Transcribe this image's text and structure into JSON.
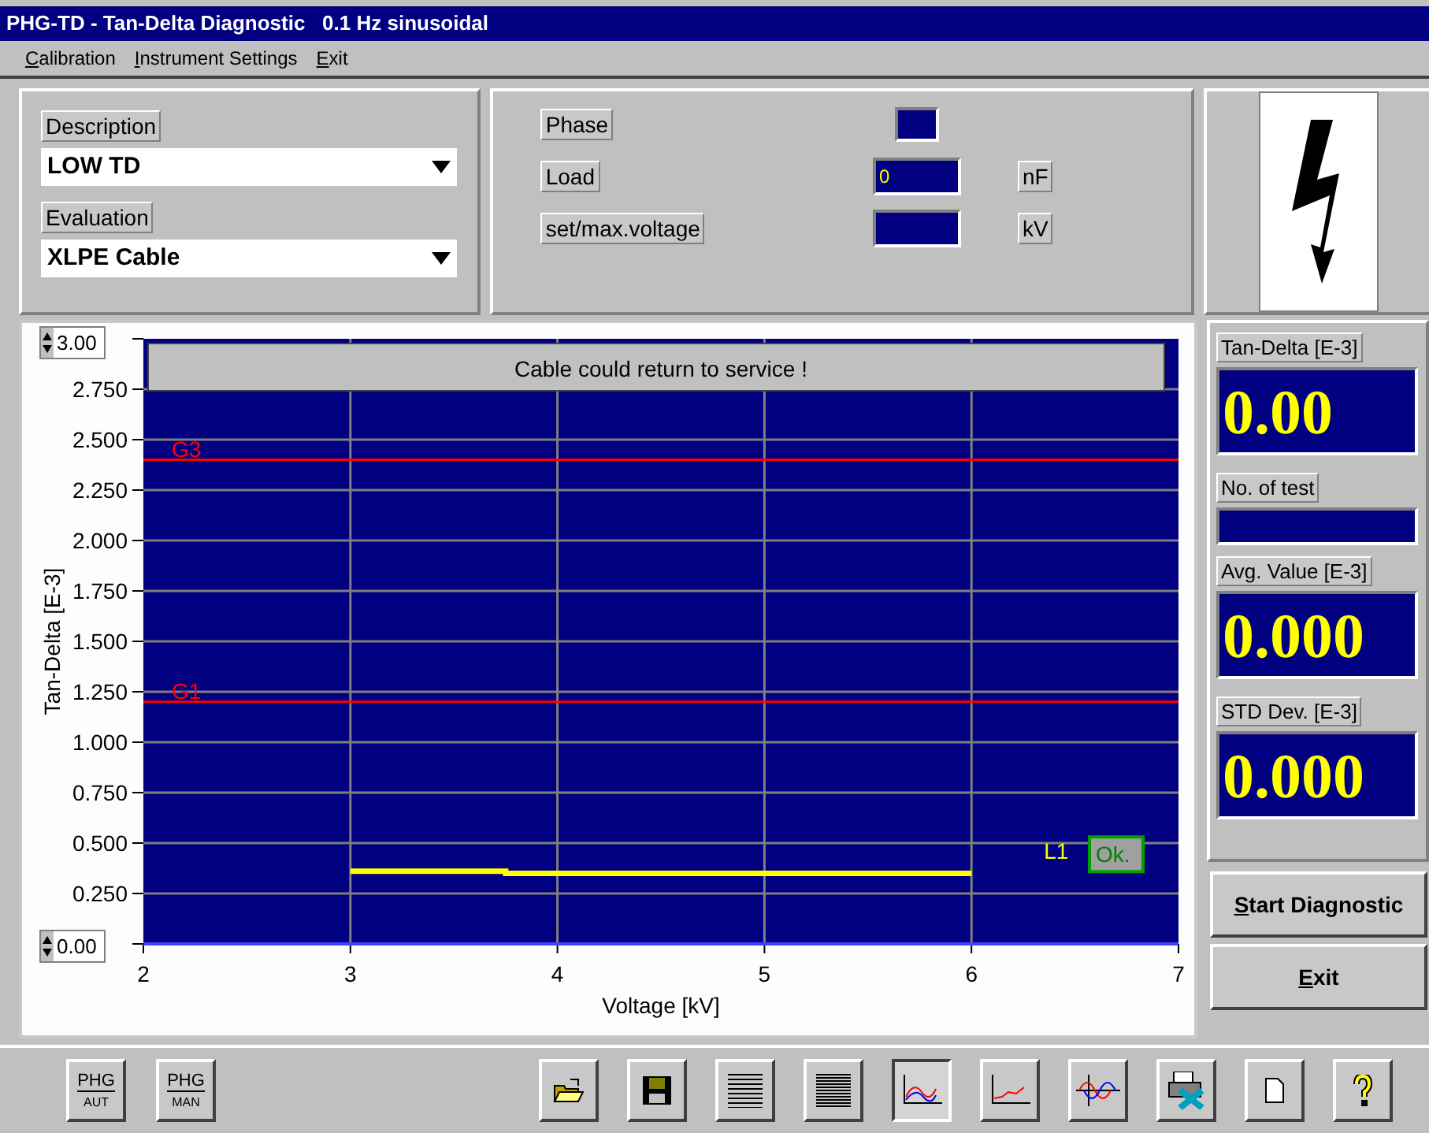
{
  "window": {
    "title": "PHG-TD - Tan-Delta Diagnostic   0.1 Hz sinusoidal"
  },
  "menu": [
    "Calibration",
    "Instrument Settings",
    "Exit"
  ],
  "description": {
    "label": "Description",
    "value": "LOW TD"
  },
  "evaluation": {
    "label": "Evaluation",
    "value": "XLPE Cable"
  },
  "readings": [
    {
      "label": "Phase",
      "kind": "indicator"
    },
    {
      "label": "Load",
      "kind": "input",
      "value": "0",
      "unit": "nF"
    },
    {
      "label": "set/max.voltage",
      "kind": "input",
      "unit": "kV"
    }
  ],
  "plot": {
    "verdict": "Cable could return to service !",
    "y_max": "3.00",
    "y_min": "0.00",
    "limit": {
      "label": "L1",
      "status": "Ok."
    },
    "chart_data": {
      "type": "line",
      "xlabel": "Voltage [kV]",
      "ylabel": "Tan-Delta [E-3]",
      "x": [
        3,
        3.75,
        3.75,
        6
      ],
      "values": [
        0.36,
        0.36,
        0.35,
        0.35
      ],
      "grid": true,
      "xlim": [
        2,
        7
      ],
      "ylim": [
        0,
        3
      ],
      "xticks": [
        2,
        3,
        4,
        5,
        6,
        7
      ],
      "yticks": [
        {
          "value": 0.25,
          "label": "0.250"
        },
        {
          "value": 0.5,
          "label": "0.500"
        },
        {
          "value": 0.75,
          "label": "0.750"
        },
        {
          "value": 1,
          "label": "1.000"
        },
        {
          "value": 1.25,
          "label": "1.250"
        },
        {
          "value": 1.5,
          "label": "1.500"
        },
        {
          "value": 1.75,
          "label": "1.750"
        },
        {
          "value": 2,
          "label": "2.000"
        },
        {
          "value": 2.25,
          "label": "2.250"
        },
        {
          "value": 2.5,
          "label": "2.500"
        },
        {
          "value": 2.75,
          "label": "2.750"
        }
      ],
      "ref_lines": [
        {
          "axis": "y",
          "value": 2.4,
          "label": "G3",
          "color": "#ff0000"
        },
        {
          "axis": "y",
          "value": 1.2,
          "label": "G1",
          "color": "#ff0000"
        }
      ]
    }
  },
  "results": [
    {
      "label": "Tan-Delta [E-3]",
      "value": "0.00"
    },
    {
      "label": "No. of test"
    },
    {
      "label": "Avg. Value [E-3]",
      "value": "0.000"
    },
    {
      "label": "STD Dev. [E-3]",
      "value": "0.000"
    }
  ],
  "actions": [
    "Start Diagnostic",
    "Exit"
  ],
  "mode_buttons": [
    {
      "top": "PHG",
      "bottom": "AUT"
    },
    {
      "top": "PHG",
      "bottom": "MAN"
    }
  ],
  "tools": [
    {
      "selected": false
    },
    {
      "selected": false
    },
    {
      "selected": false
    },
    {
      "selected": false
    },
    {
      "selected": true
    },
    {
      "selected": false
    },
    {
      "selected": false
    },
    {
      "selected": false
    },
    {
      "selected": false
    },
    {
      "selected": false
    }
  ]
}
